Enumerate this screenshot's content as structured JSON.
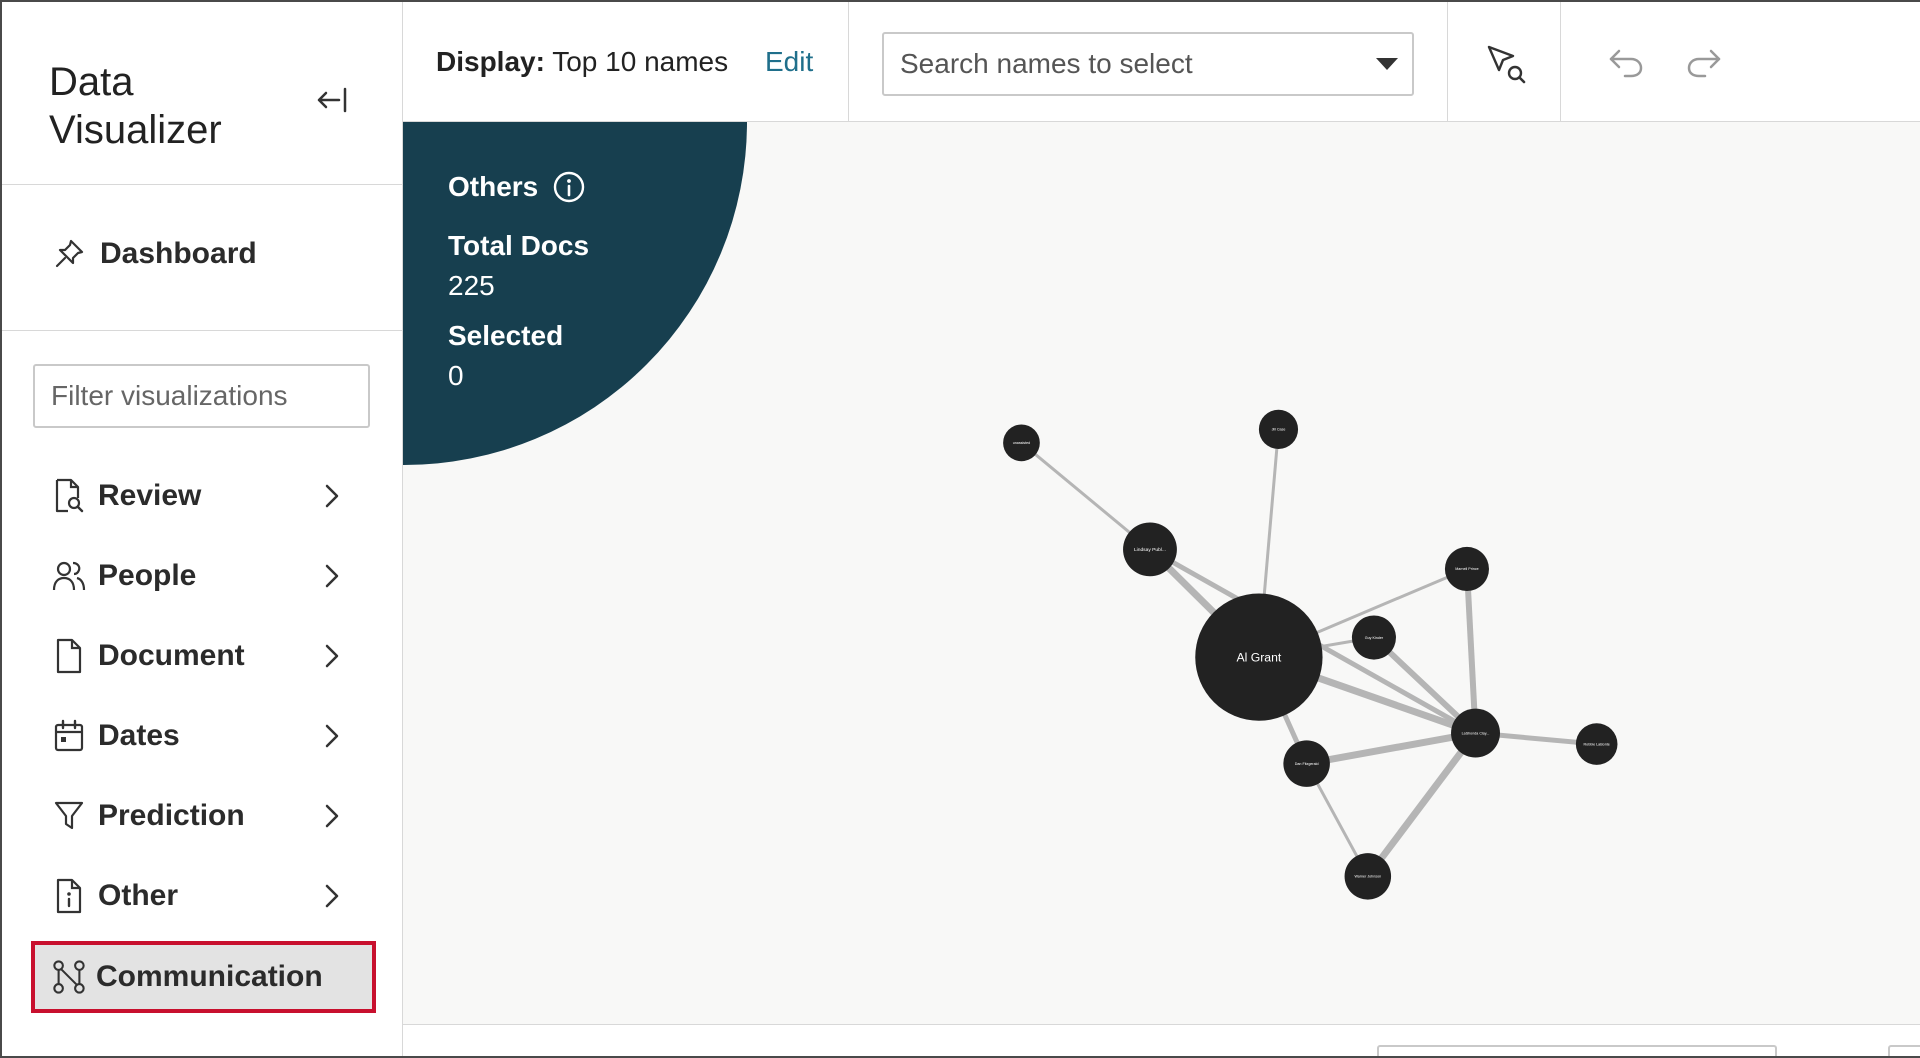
{
  "sidebar": {
    "title": "Data Visualizer",
    "dashboard_label": "Dashboard",
    "filter_placeholder": "Filter visualizations",
    "items": [
      {
        "label": "Review",
        "icon": "document-search-icon"
      },
      {
        "label": "People",
        "icon": "people-icon"
      },
      {
        "label": "Document",
        "icon": "document-icon"
      },
      {
        "label": "Dates",
        "icon": "calendar-icon"
      },
      {
        "label": "Prediction",
        "icon": "filter-icon"
      },
      {
        "label": "Other",
        "icon": "info-document-icon"
      }
    ],
    "active_item": {
      "label": "Communication",
      "icon": "communication-network-icon"
    }
  },
  "toolbar": {
    "display_label": "Display:",
    "display_value": "Top 10 names",
    "edit_label": "Edit",
    "search_placeholder": "Search names to select"
  },
  "others_panel": {
    "title": "Others",
    "total_docs_label": "Total Docs",
    "total_docs_value": "225",
    "selected_label": "Selected",
    "selected_value": "0"
  },
  "graph": {
    "nodes": [
      {
        "id": "algrant",
        "label": "Al Grant"
      },
      {
        "id": "lindsay",
        "label": "Lindsay Publ..."
      },
      {
        "id": "n1",
        "label": "unassisted"
      },
      {
        "id": "jillcase",
        "label": "Jill Case"
      },
      {
        "id": "mornell",
        "label": "Marnell Prince"
      },
      {
        "id": "guykinder",
        "label": "Guy Kinder"
      },
      {
        "id": "lashonda",
        "label": "LaShonda Clay..."
      },
      {
        "id": "danfitz",
        "label": "Dan Fitzgerald"
      },
      {
        "id": "robbie",
        "label": "Robbie LaBonte"
      },
      {
        "id": "warner",
        "label": "Warner Johnson"
      }
    ]
  },
  "colors": {
    "panel": "#173f4f",
    "node": "#222222",
    "edge": "#b5b5b5",
    "accent_link": "#1f6f8b",
    "highlight_border": "#c8102e"
  }
}
